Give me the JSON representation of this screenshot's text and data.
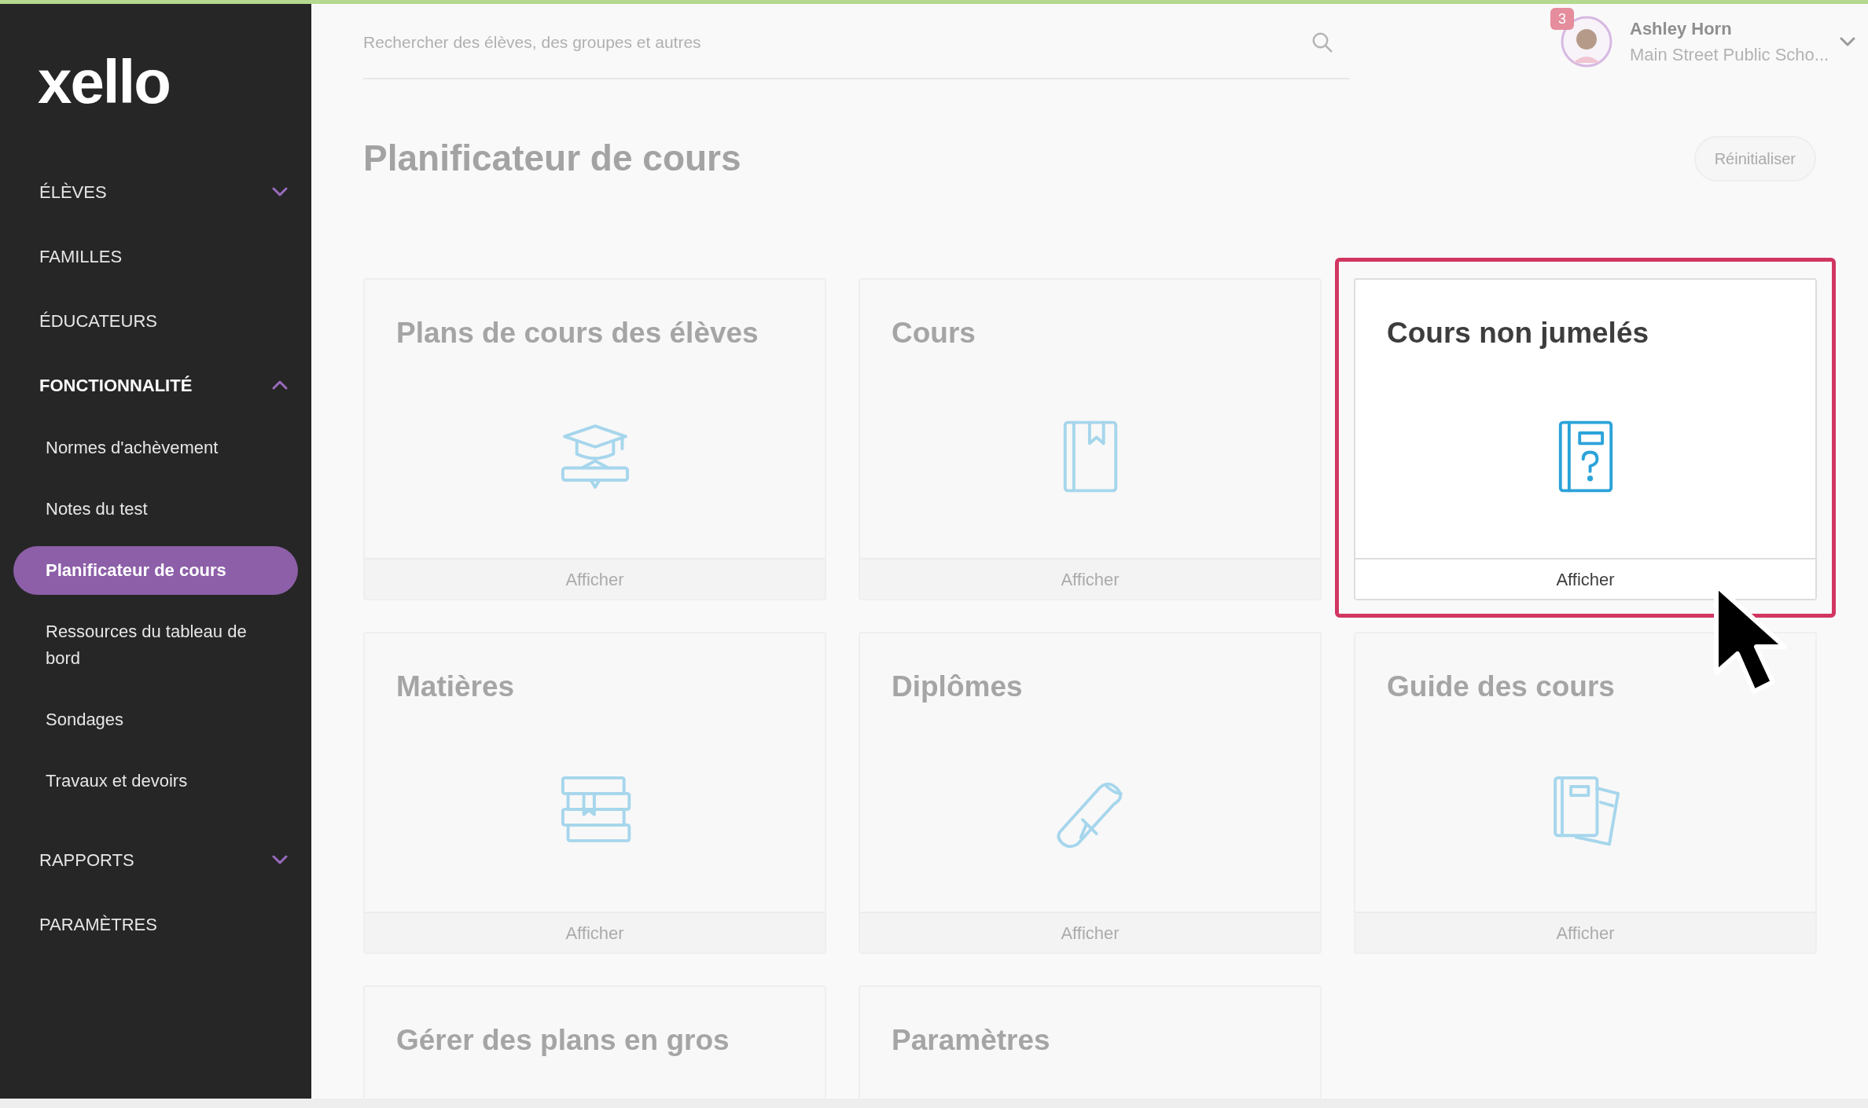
{
  "sidebar": {
    "logo": "xello",
    "items": [
      {
        "label": "ÉLÈVES",
        "selected": false,
        "expanded": false
      },
      {
        "label": "FAMILLES",
        "selected": false
      },
      {
        "label": "ÉDUCATEURS",
        "selected": false
      },
      {
        "label": "FONCTIONNALITÉ",
        "selected": true,
        "expanded": true,
        "children": [
          {
            "label": "Normes d'achèvement",
            "selected": false
          },
          {
            "label": "Notes du test",
            "selected": false
          },
          {
            "label": "Planificateur de cours",
            "selected": true
          },
          {
            "label": "Ressources du tableau de bord",
            "selected": false
          },
          {
            "label": "Sondages",
            "selected": false
          },
          {
            "label": "Travaux et devoirs",
            "selected": false
          }
        ]
      },
      {
        "label": "RAPPORTS",
        "selected": false,
        "expanded": false
      },
      {
        "label": "PARAMÈTRES",
        "selected": false
      }
    ]
  },
  "search": {
    "placeholder": "Rechercher des élèves, des groupes et autres"
  },
  "user": {
    "name": "Ashley Horn",
    "school": "Main Street Public Scho...",
    "badge": "3"
  },
  "page": {
    "title": "Planificateur de cours",
    "reset_button": "Réinitialiser"
  },
  "cards": [
    {
      "title": "Plans de cours des élèves",
      "action": "Afficher",
      "highlighted": false
    },
    {
      "title": "Cours",
      "action": "Afficher",
      "highlighted": false
    },
    {
      "title": "Cours non jumelés",
      "action": "Afficher",
      "highlighted": true
    },
    {
      "title": "Matières",
      "action": "Afficher",
      "highlighted": false
    },
    {
      "title": "Diplômes",
      "action": "Afficher",
      "highlighted": false
    },
    {
      "title": "Guide des cours",
      "action": "Afficher",
      "highlighted": false
    },
    {
      "title": "Gérer des plans en gros",
      "highlighted": false
    },
    {
      "title": "Paramètres",
      "highlighted": false
    }
  ]
}
